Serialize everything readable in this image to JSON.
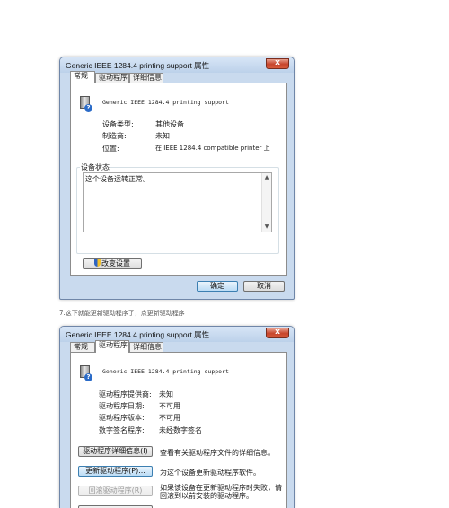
{
  "window1": {
    "title": "Generic IEEE 1284.4 printing support 属性",
    "close_glyph": "x",
    "tabs": [
      {
        "label": "常规"
      },
      {
        "label": "驱动程序"
      },
      {
        "label": "详细信息"
      }
    ],
    "device_name": "Generic IEEE 1284.4 printing support",
    "props": [
      {
        "label": "设备类型:",
        "value": "其他设备"
      },
      {
        "label": "制造商:",
        "value": "未知"
      },
      {
        "label": "位置:",
        "value": "在 IEEE 1284.4 compatible printer 上"
      }
    ],
    "status_group_title": "设备状态",
    "status_text": "这个设备运转正常。",
    "change_settings_label": "改变设置",
    "ok_label": "确定",
    "cancel_label": "取消"
  },
  "caption": {
    "number": "7",
    "text": ".这下就能更新驱动程序了，点更新驱动程序"
  },
  "window2": {
    "title": "Generic IEEE 1284.4 printing support 属性",
    "close_glyph": "x",
    "tabs": [
      {
        "label": "常规"
      },
      {
        "label": "驱动程序"
      },
      {
        "label": "详细信息"
      }
    ],
    "device_name": "Generic IEEE 1284.4 printing support",
    "props": [
      {
        "label": "驱动程序提供商:",
        "value": "未知"
      },
      {
        "label": "驱动程序日期:",
        "value": "不可用"
      },
      {
        "label": "驱动程序版本:",
        "value": "不可用"
      },
      {
        "label": "数字签名程序:",
        "value": "未经数字签名"
      }
    ],
    "actions": [
      {
        "button": "驱动程序详细信息(I)",
        "desc": "查看有关驱动程序文件的详细信息。"
      },
      {
        "button": "更新驱动程序(P)...",
        "desc": "为这个设备更新驱动程序软件。"
      },
      {
        "button": "回滚驱动程序(R)",
        "desc_line1": "如果该设备在更新驱动程序时失败，请",
        "desc_line2": "回滚到以前安装的驱动程序。"
      }
    ]
  },
  "colors": {
    "title_bar": "#c9daee",
    "close_button": "#c7452c",
    "focus_button": "#bcdcf5"
  },
  "icons": {
    "device": "unknown-device-icon",
    "shield": "uac-shield-icon"
  }
}
